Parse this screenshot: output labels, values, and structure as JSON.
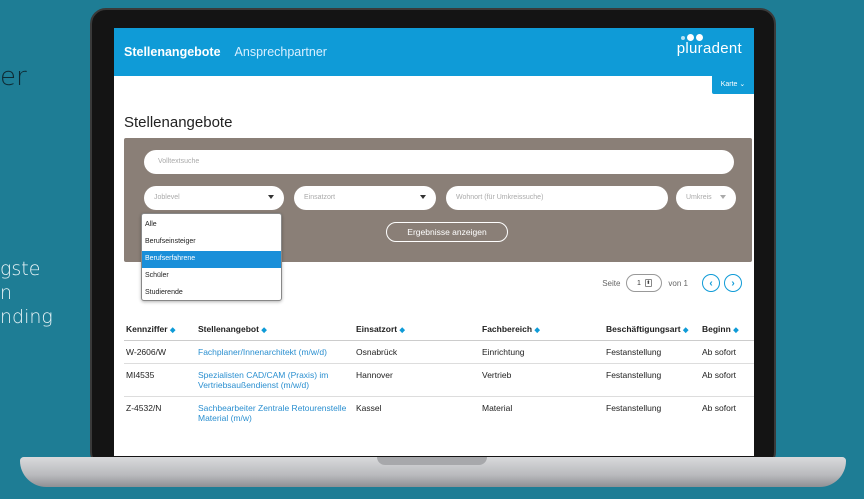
{
  "side_text": {
    "head": "er",
    "lines": [
      "gste",
      "n",
      "nding"
    ]
  },
  "header": {
    "nav": [
      "Stellenangebote",
      "Ansprechpartner"
    ],
    "logo": "pluradent",
    "karte_label": "Karte ⌄"
  },
  "page": {
    "title": "Stellenangebote"
  },
  "filter": {
    "search_placeholder": "Volltextsuche",
    "joblevel_placeholder": "Joblevel",
    "einsatzort_placeholder": "Einsatzort",
    "wohnort_placeholder": "Wohnort (für Umkreissuche)",
    "umkreis_placeholder": "Umkreis",
    "results_button": "Ergebnisse anzeigen",
    "joblevel_options": [
      "Alle",
      "Berufseinsteiger",
      "Berufserfahrene",
      "Schüler",
      "Studierende"
    ],
    "selected_option_index": 2
  },
  "pagination": {
    "prefix": "Seite",
    "current": "1",
    "suffix": "von 1"
  },
  "table": {
    "columns": [
      "Kennziffer",
      "Stellenangebot",
      "Einsatzort",
      "Fachbereich",
      "Beschäftigungsart",
      "Beginn"
    ],
    "rows": [
      {
        "id": "W-2606/W",
        "title": "Fachplaner/Innenarchitekt (m/w/d)",
        "ort": "Osnabrück",
        "bereich": "Einrichtung",
        "art": "Festanstellung",
        "beginn": "Ab sofort"
      },
      {
        "id": "MI4535",
        "title": "Spezialisten CAD/CAM (Praxis) im Vertriebsaußendienst (m/w/d)",
        "ort": "Hannover",
        "bereich": "Vertrieb",
        "art": "Festanstellung",
        "beginn": "Ab sofort"
      },
      {
        "id": "Z-4532/N",
        "title": "Sachbearbeiter Zentrale Retourenstelle Material (m/w)",
        "ort": "Kassel",
        "bereich": "Material",
        "art": "Festanstellung",
        "beginn": "Ab sofort"
      }
    ]
  },
  "colors": {
    "background": "#1e7d95",
    "topbar": "#0f9bd7",
    "filter_panel": "#8a7f77",
    "link": "#2a8fd0",
    "selected_option": "#1a8fd9"
  }
}
